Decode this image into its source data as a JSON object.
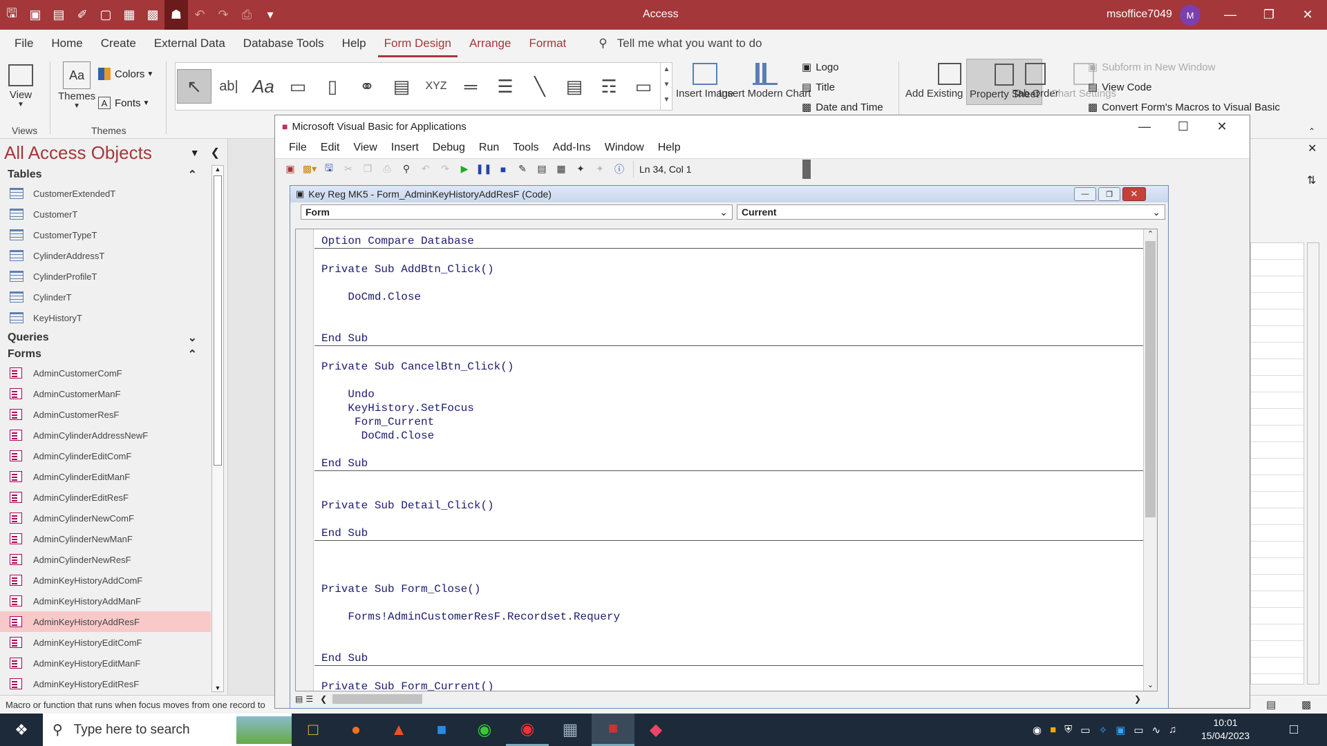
{
  "titlebar": {
    "app": "Access",
    "user": "msoffice7049",
    "avatar": "M"
  },
  "tabs": [
    "File",
    "Home",
    "Create",
    "External Data",
    "Database Tools",
    "Help",
    "Form Design",
    "Arrange",
    "Format"
  ],
  "tell_me": "Tell me what you want to do",
  "ribbon": {
    "view": "View",
    "themes": "Themes",
    "colors": "Colors",
    "fonts": "Fonts",
    "group_views": "Views",
    "group_themes": "Themes",
    "insert_image": "Insert Image",
    "insert_modern_chart": "Insert Modern Chart",
    "logo": "Logo",
    "title": "Title",
    "date_time": "Date and Time",
    "add_existing_fields": "Add Existing Fields",
    "property_sheet": "Property Sheet",
    "tab_order": "Tab Order",
    "chart_settings": "Chart Settings",
    "subform_new_window": "Subform in New Window",
    "view_code": "View Code",
    "convert_macros": "Convert Form's Macros to Visual Basic"
  },
  "nav": {
    "header": "All Access Objects",
    "tables_label": "Tables",
    "tables": [
      "CustomerExtendedT",
      "CustomerT",
      "CustomerTypeT",
      "CylinderAddressT",
      "CylinderProfileT",
      "CylinderT",
      "KeyHistoryT"
    ],
    "queries_label": "Queries",
    "forms_label": "Forms",
    "forms": [
      "AdminCustomerComF",
      "AdminCustomerManF",
      "AdminCustomerResF",
      "AdminCylinderAddressNewF",
      "AdminCylinderEditComF",
      "AdminCylinderEditManF",
      "AdminCylinderEditResF",
      "AdminCylinderNewComF",
      "AdminCylinderNewManF",
      "AdminCylinderNewResF",
      "AdminKeyHistoryAddComF",
      "AdminKeyHistoryAddManF",
      "AdminKeyHistoryAddResF",
      "AdminKeyHistoryEditComF",
      "AdminKeyHistoryEditManF",
      "AdminKeyHistoryEditResF"
    ],
    "selected_form": "AdminKeyHistoryAddResF"
  },
  "vba": {
    "title": "Microsoft Visual Basic for Applications",
    "menu": [
      "File",
      "Edit",
      "View",
      "Insert",
      "Debug",
      "Run",
      "Tools",
      "Add-Ins",
      "Window",
      "Help"
    ],
    "position": "Ln 34, Col 1",
    "code_title": "Key Reg MK5 - Form_AdminKeyHistoryAddResF (Code)",
    "object_combo": "Form",
    "proc_combo": "Current",
    "code": [
      "Option Compare Database",
      "",
      "Private Sub AddBtn_Click()",
      "",
      "    DoCmd.Close",
      "",
      "",
      "End Sub",
      "",
      "Private Sub CancelBtn_Click()",
      "",
      "    Undo",
      "    KeyHistory.SetFocus",
      "     Form_Current",
      "      DoCmd.Close",
      "",
      "End Sub",
      "",
      "",
      "Private Sub Detail_Click()",
      "",
      "End Sub",
      "",
      "",
      "",
      "Private Sub Form_Close()",
      "",
      "    Forms!AdminCustomerResF.Recordset.Requery",
      "",
      "",
      "End Sub",
      "",
      "Private Sub Form_Current()"
    ]
  },
  "status": "Macro or function that runs when focus moves from one record to",
  "taskbar": {
    "search": "Type here to search",
    "time": "10:01",
    "date": "15/04/2023"
  }
}
